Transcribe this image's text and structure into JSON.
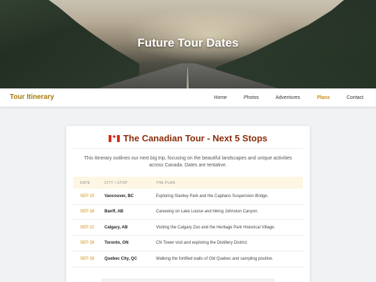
{
  "hero": {
    "title": "Future Tour Dates"
  },
  "nav": {
    "brand": "Tour Itinerary",
    "links": [
      "Home",
      "Photos",
      "Adventures",
      "Plans",
      "Contact"
    ],
    "active": "Plans"
  },
  "card": {
    "title": "The Canadian Tour - Next 5 Stops",
    "intro": "This itinerary outlines our next big trip, focusing on the beautiful landscapes and unique activities across Canada. Dates are tentative.",
    "columns": [
      "DATE",
      "CITY / STOP",
      "THE PLAN"
    ],
    "rows": [
      {
        "date": "SEP 15",
        "city": "Vancouver, BC",
        "plan": "Exploring Stanley Park and the Capilano Suspension Bridge."
      },
      {
        "date": "SEP 18",
        "city": "Banff, AB",
        "plan": "Canoeing on Lake Louise and hiking Johnston Canyon."
      },
      {
        "date": "SEP 22",
        "city": "Calgary, AB",
        "plan": "Visiting the Calgary Zoo and the Heritage Park Historical Village."
      },
      {
        "date": "SEP 26",
        "city": "Toronto, ON",
        "plan": "CN Tower visit and exploring the Distillery District."
      },
      {
        "date": "SEP 29",
        "city": "Quebec City, QC",
        "plan": "Walking the fortified walls of Old Quebec and sampling poutine."
      }
    ]
  },
  "colors": {
    "accent": "#d08a10",
    "brand": "#a77a0a",
    "title": "#8b2d0b",
    "header_bg": "#fdf6e2"
  },
  "icons": {
    "flag": "canada-flag-icon"
  }
}
